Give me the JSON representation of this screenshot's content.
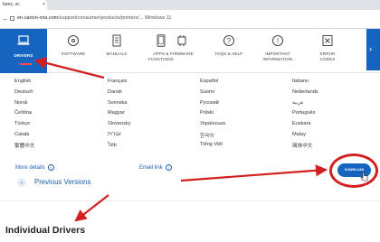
{
  "browser": {
    "tab_title": "bees, sc",
    "url_host": "en.canon-cna.com",
    "url_path": "/support/consumer/products/printers/...",
    "url_tail": "Windows 11"
  },
  "nav": {
    "items": [
      {
        "label": "DRIVERS",
        "icon": "laptop-icon"
      },
      {
        "label": "SOFTWARE",
        "icon": "disc-icon"
      },
      {
        "label": "MANUALS",
        "icon": "document-icon"
      },
      {
        "label": "APPS &\nFUNCTIONS",
        "icon": "tablet-icon"
      },
      {
        "label": "FIRMWARE",
        "icon": "chip-icon"
      },
      {
        "label": "FAQS & HELP",
        "icon": "question-icon"
      },
      {
        "label": "IMPORTANT\nINFORMATION",
        "icon": "info-icon"
      },
      {
        "label": "ERROR\nCODES",
        "icon": "error-icon"
      }
    ]
  },
  "languages": [
    "English",
    "Français",
    "Español",
    "Italiano",
    "Deutsch",
    "Dansk",
    "Suomi",
    "Nederlands",
    "Norsk",
    "Svenska",
    "Русский",
    "عربية",
    "Čeština",
    "Magyar",
    "Polski",
    "Português",
    "Türkçe",
    "Slovensky",
    "Українська",
    "Euskara",
    "Català",
    "עברית",
    "한국어",
    "Malay",
    "繁體中文",
    "ไทย",
    "Tiếng Việt",
    "简体中文"
  ],
  "links": {
    "more_details": "More details",
    "email_link": "Email link",
    "previous_versions": "Previous Versions"
  },
  "download": {
    "label": "DOWNLOAD"
  },
  "section": {
    "heading": "Individual Drivers"
  },
  "colors": {
    "accent": "#1565c0",
    "annotation": "#d21f1f"
  }
}
